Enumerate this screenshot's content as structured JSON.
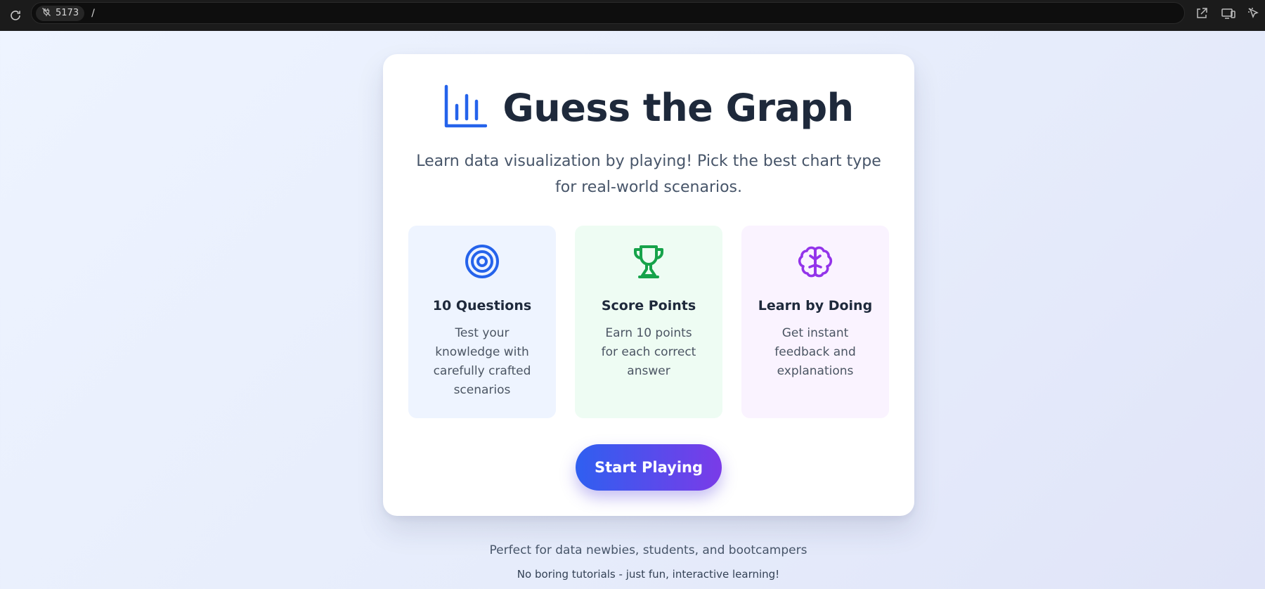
{
  "browser": {
    "port": "5173",
    "path": "/",
    "icons": [
      "reload-icon",
      "no-plug-icon",
      "open-external-icon",
      "device-toggle-icon",
      "inspect-cursor-icon"
    ]
  },
  "header": {
    "title": "Guess the Graph",
    "icon": "bar-chart-icon",
    "subtitle": "Learn data visualization by playing! Pick the best chart type for real-world scenarios."
  },
  "features": [
    {
      "icon": "target-icon",
      "title": "10 Questions",
      "description": "Test your knowledge with carefully crafted scenarios",
      "color": "#2563eb"
    },
    {
      "icon": "trophy-icon",
      "title": "Score Points",
      "description": "Earn 10 points for each correct answer",
      "color": "#16a34a"
    },
    {
      "icon": "brain-icon",
      "title": "Learn by Doing",
      "description": "Get instant feedback and explanations",
      "color": "#9333ea"
    }
  ],
  "cta": {
    "label": "Start Playing"
  },
  "footer": {
    "line1": "Perfect for data newbies, students, and bootcampers",
    "line2": "No boring tutorials - just fun, interactive learning!"
  },
  "colors": {
    "accent_blue": "#2563eb",
    "accent_purple": "#7a3be8",
    "title": "#1e293b"
  }
}
